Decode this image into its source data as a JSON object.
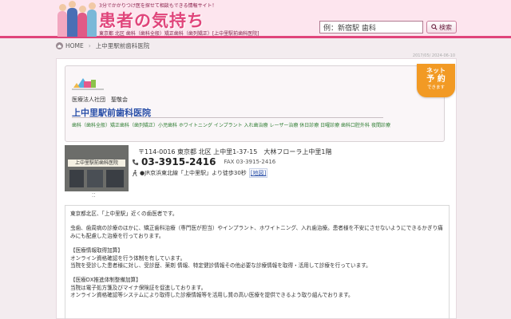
{
  "header": {
    "tagline": "3分でかかりつけ医を探せて相談もできる情報サイト！",
    "title": "患者の気持ち",
    "subnav": "東京都 北区 歯科（歯科全般）矯正歯科（歯列矯正）[上中里駅前歯科医院]",
    "search_placeholder": "例：新宿駅 歯科",
    "search_label": "検索"
  },
  "breadcrumb": {
    "home": "HOME",
    "current": "上中里駅前歯科医院"
  },
  "updated_date": "2017/05/ 2024-06-10",
  "clinic": {
    "corporation": "医療法人社団　聖敬会",
    "name": "上中里駅前歯科医院",
    "categories": "歯科（歯科全般）矯正歯科（歯列矯正）小児歯科 ホワイトニング インプラント 入れ歯治療 レーザー治療 休日診療 日曜診療 歯科口腔外科 夜間診療",
    "net_badge": {
      "line1": "ネット",
      "line2": "予 約",
      "line3": "できます"
    },
    "photo_sign": "上中里駅前歯科医院",
    "photo_dots": "⁚⁚",
    "address": "〒114-0016 東京都 北区 上中里1-37-15　大林フローラ上中里1階",
    "phone": "03-3915-2416",
    "fax": "FAX 03-3915-2416",
    "access": "●JR京浜東北線「上中里駅」より徒歩30秒",
    "map_link": "[地図]"
  },
  "description": {
    "intro": "東京都北区、「上中里駅」近くの歯医者です。",
    "body": "虫歯、歯周病の診療のほかに、矯正歯科治療（専門医が担当）やインプラント、ホワイトニング、入れ歯治療。患者様を不安にさせないようにできるかぎり痛みにも配慮した治療を行っております。",
    "section1_title": "【医療情報取得加算】",
    "section1_line1": "オンライン資格確認を行う体制を有しています。",
    "section1_line2": "当院を受診した患者様に対し、受診歴、薬剤 情報、特定健診情報その他必要な診療情報を取得・活用して診療を行っています。",
    "section2_title": "【医療DX推進体制整備加算】",
    "section2_line1": "当院は電子処方箋及びマイナ保険証を促進しております。",
    "section2_line2": "オンライン資格確認等システムにより取得した診療情報等を活用し質の高い医療を提供できるよう取り組んでおります。"
  },
  "colors": {
    "brand_pink": "#e0457b",
    "clinic_blue": "#2a4fa8",
    "category_green": "#2e7d32",
    "badge_orange": "#f29a24"
  },
  "icons": [
    "home-icon",
    "search-icon",
    "phone-icon",
    "walk-icon"
  ]
}
